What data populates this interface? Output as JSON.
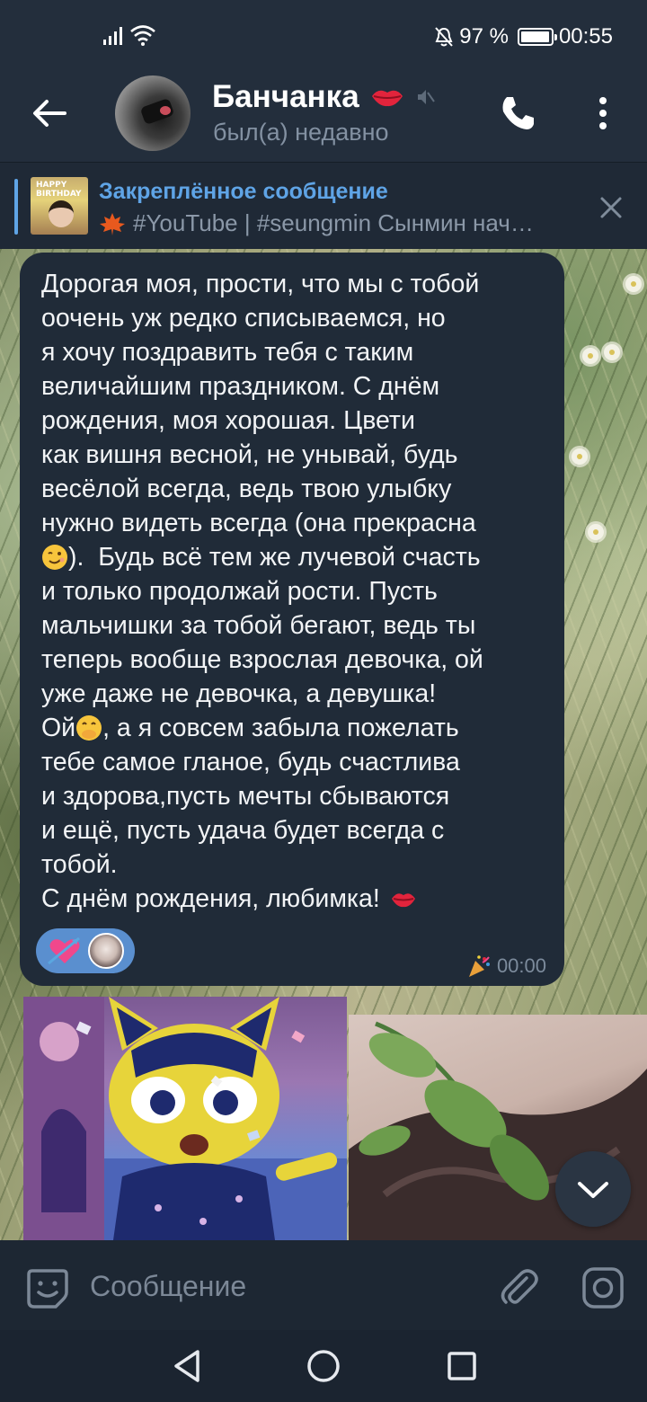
{
  "status_bar": {
    "battery_text": "97 %",
    "battery_level": 0.97,
    "time": "00:55",
    "icons": [
      "signal-icon",
      "wifi-icon",
      "bell-off-icon",
      "battery-icon"
    ]
  },
  "header": {
    "contact_name": "Банчанка",
    "last_seen": "был(а) недавно",
    "icons": [
      "back-arrow-icon",
      "kiss-lips-icon",
      "mute-icon",
      "phone-icon",
      "more-vertical-icon"
    ]
  },
  "pinned": {
    "title": "Закреплённое сообщение",
    "thumbnail_text": "HAPPY BIRTHDAY",
    "preview_text": "#YouTube | #seungmin  Сынмин нач…",
    "icons": [
      "maple-leaf-icon",
      "close-icon"
    ]
  },
  "message": {
    "part1": "Дорогая моя, прости, что мы с тобой\nоочень уж редко списываемся, но\nя хочу поздравить тебя с таким\nвеличайшим праздником. С днём\nрождения, моя хорошая. Цвети\nкак вишня весной, не унывай, будь\nвесёлой всегда, ведь твою улыбку\nнужно видеть всегда (она прекрасна\n",
    "part2": ").  Будь всё тем же лучевой счасть\nи только продолжай рости. Пусть\nмальчишки за тобой бегают, ведь ты\nтеперь вообще взрослая девочка, ой\nуже даже не девочка, а девушка!\nОй",
    "part3": ", а я совсем забыла пожелать\nтебе самое гланое, будь счастлива\nи здорова,пусть мечты сбываются\nи ещё, пусть удача будет всегда с\nтобой.\nС днём рождения, любимка! ",
    "time": "00:00",
    "inline_emojis": [
      "winking-face-emoji",
      "face-with-hand-over-mouth-emoji",
      "kiss-mark-emoji"
    ],
    "reactions": [
      "heart-with-arrow-icon",
      "reactor-avatar"
    ]
  },
  "photos": [
    "animal-crossing-photo",
    "leaf-and-hair-photo"
  ],
  "input": {
    "placeholder": "Сообщение",
    "value": ""
  },
  "colors": {
    "header_bg": "#232e3c",
    "bubble_bg": "#202b38",
    "accent": "#5fa4e6",
    "reaction_bg": "#5a8fcf",
    "muted_text": "#8391a2"
  }
}
